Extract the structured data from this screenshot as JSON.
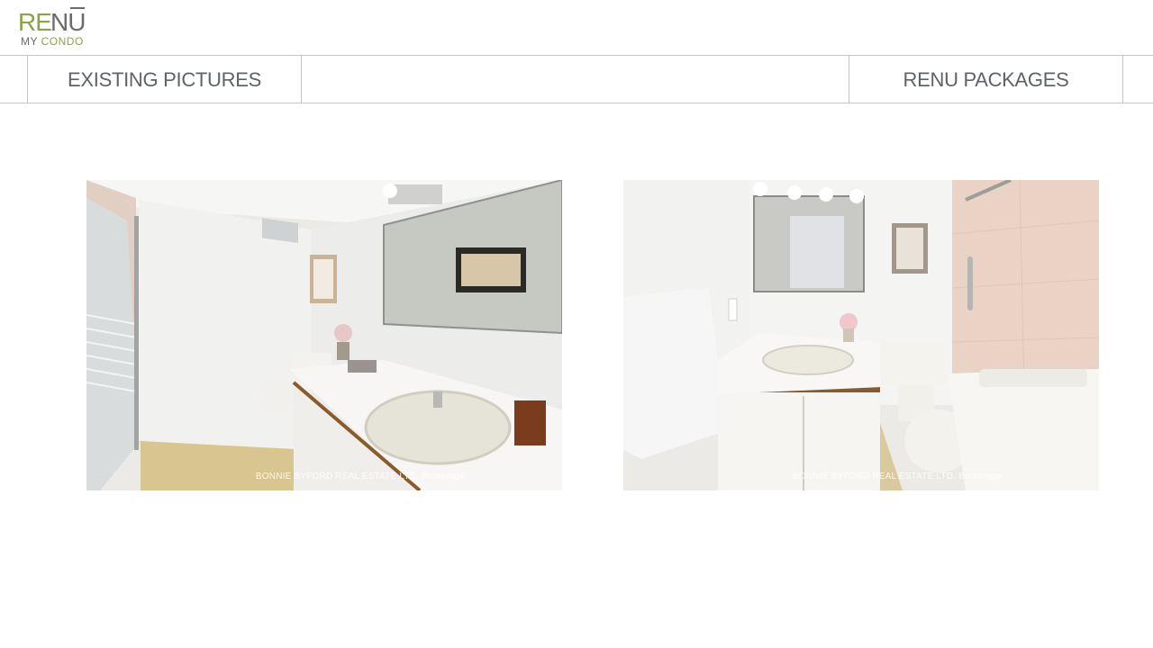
{
  "brand": {
    "logo_re": "RE",
    "logo_nu": "NU",
    "logo_my": "MY ",
    "logo_condo": "CONDO",
    "accent_color": "#8aa34a",
    "text_color": "#6b6b6b"
  },
  "nav": {
    "tabs": [
      {
        "label": "EXISTING PICTURES"
      },
      {
        "label": "RENU PACKAGES"
      }
    ]
  },
  "gallery": {
    "photos": [
      {
        "watermark": "BONNIE BYFORD REAL ESTATE LTD. Brokerage",
        "subject": "bathroom-vanity-shower"
      },
      {
        "watermark": "BONNIE BYFORD REAL ESTATE LTD. Brokerage",
        "subject": "bathroom-toilet-tub"
      }
    ]
  }
}
